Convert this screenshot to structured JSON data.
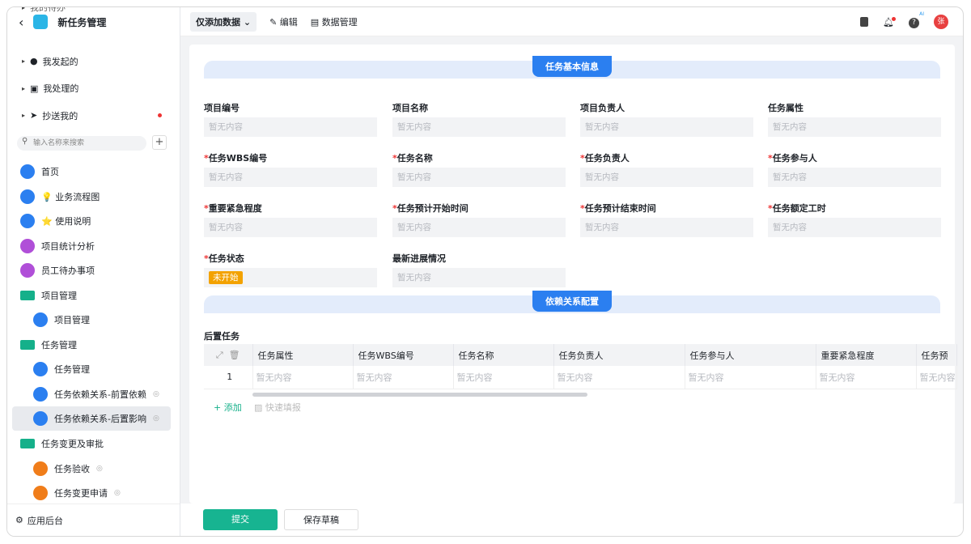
{
  "app": {
    "title": "新任务管理"
  },
  "sidebar": {
    "groups": [
      {
        "label": "我的待办"
      },
      {
        "label": "我发起的"
      },
      {
        "label": "我处理的"
      },
      {
        "label": "抄送我的"
      }
    ],
    "search_placeholder": "输入名称来搜索",
    "items": [
      {
        "label": "首页",
        "color": "#2b7ff0"
      },
      {
        "label": "💡 业务流程图",
        "color": "#2b7ff0"
      },
      {
        "label": "⭐ 使用说明",
        "color": "#2b7ff0"
      },
      {
        "label": "项目统计分析",
        "color": "#b04fd8"
      },
      {
        "label": "员工待办事项",
        "color": "#b04fd8"
      },
      {
        "label": "项目管理",
        "color": "#15b08a"
      },
      {
        "label": "项目管理",
        "color": "#2b7ff0"
      },
      {
        "label": "任务管理",
        "color": "#15b08a"
      },
      {
        "label": "任务管理",
        "color": "#2b7ff0"
      },
      {
        "label": "任务依赖关系-前置依赖",
        "color": "#2b7ff0"
      },
      {
        "label": "任务依赖关系-后置影响",
        "color": "#2b7ff0"
      },
      {
        "label": "任务变更及审批",
        "color": "#15b08a"
      },
      {
        "label": "任务验收",
        "color": "#f07d1a"
      },
      {
        "label": "任务变更申请",
        "color": "#f07d1a"
      }
    ],
    "footer": "应用后台"
  },
  "toolbar": {
    "mode": "仅添加数据",
    "edit": "编辑",
    "data_manage": "数据管理",
    "avatar": "张",
    "ai_badge": "AI"
  },
  "form": {
    "section1": "任务基本信息",
    "section2": "依赖关系配置",
    "empty": "暂无内容",
    "fields": [
      {
        "label": "项目编号",
        "required": false
      },
      {
        "label": "项目名称",
        "required": false
      },
      {
        "label": "项目负责人",
        "required": false
      },
      {
        "label": "任务属性",
        "required": false
      },
      {
        "label": "任务WBS编号",
        "required": true
      },
      {
        "label": "任务名称",
        "required": true
      },
      {
        "label": "任务负责人",
        "required": true
      },
      {
        "label": "任务参与人",
        "required": true
      },
      {
        "label": "重要紧急程度",
        "required": true
      },
      {
        "label": "任务预计开始时间",
        "required": true
      },
      {
        "label": "任务预计结束时间",
        "required": true
      },
      {
        "label": "任务额定工时",
        "required": true
      },
      {
        "label": "任务状态",
        "required": true,
        "value": "未开始"
      },
      {
        "label": "最新进展情况",
        "required": false
      }
    ],
    "subtable": {
      "title": "后置任务",
      "columns": [
        "任务属性",
        "任务WBS编号",
        "任务名称",
        "任务负责人",
        "任务参与人",
        "重要紧急程度",
        "任务预"
      ],
      "row_index": "1",
      "add": "+ 添加",
      "quick": "快速填报"
    }
  },
  "actions": {
    "submit": "提交",
    "draft": "保存草稿"
  }
}
